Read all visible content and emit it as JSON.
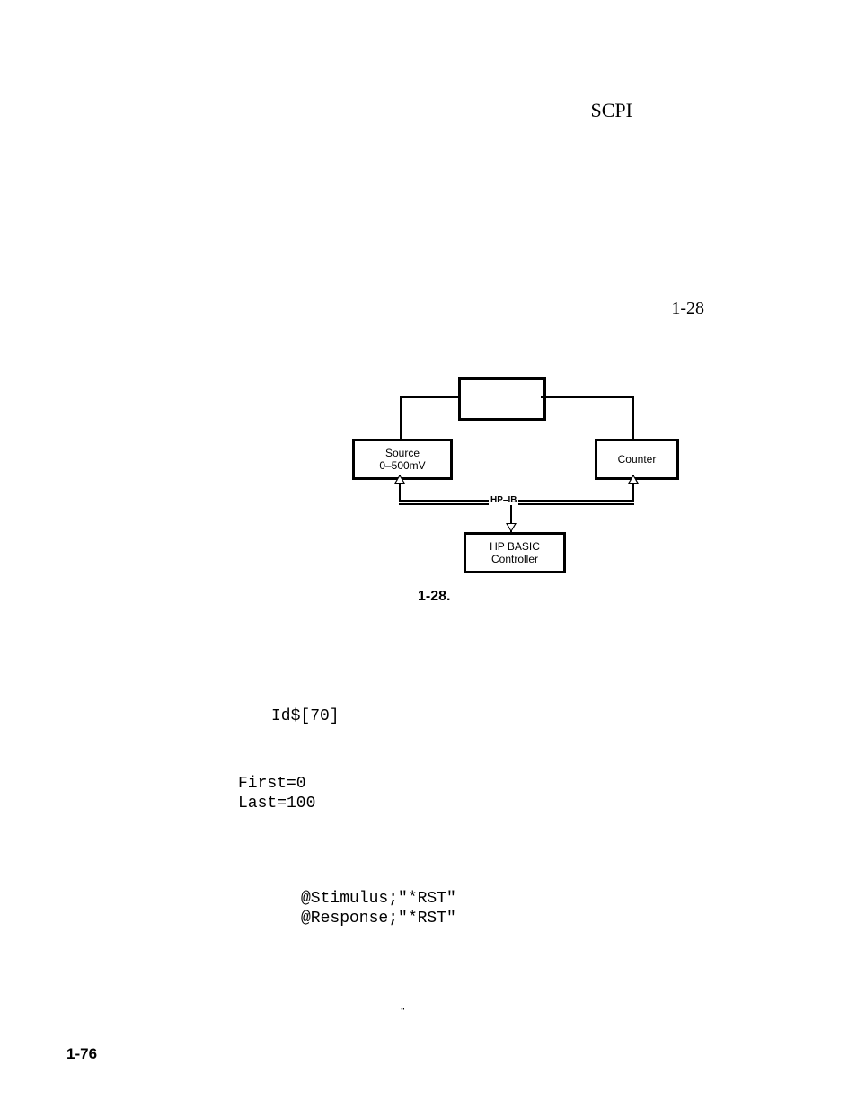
{
  "header": {
    "title": "SCPI"
  },
  "page_reference": "1-28",
  "diagram": {
    "boxes": {
      "source_line1": "Source",
      "source_line2": "0–500mV",
      "counter": "Counter",
      "controller_line1": "HP  BASIC",
      "controller_line2": "Controller"
    },
    "bus_label": "HP–IB",
    "caption": "1-28."
  },
  "code": {
    "line1": "Id$[70]",
    "line2": "First=0",
    "line3": "Last=100",
    "line4": "@Stimulus;\"*RST\"",
    "line5": "@Response;\"*RST\""
  },
  "tiny_mark": "\"",
  "footer": {
    "page": "1-76"
  }
}
